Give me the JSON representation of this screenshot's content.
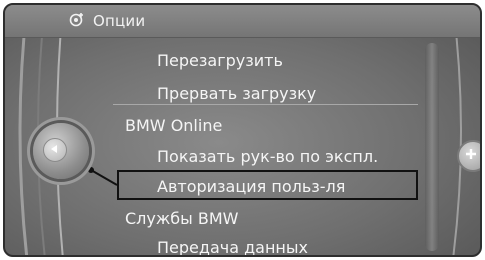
{
  "header": {
    "title": "Опции",
    "icon": "options-gear-icon"
  },
  "menu": {
    "items": [
      {
        "label": "Перезагрузить"
      },
      {
        "label": "Прервать загрузку"
      },
      {
        "label": "BMW Online"
      },
      {
        "label": "Показать рук-во по экспл."
      },
      {
        "label": "Авторизация польз-ля"
      },
      {
        "label": "Службы BMW"
      },
      {
        "label": "Передача данных"
      }
    ],
    "selected": "Авторизация польз-ля"
  },
  "controls": {
    "left_knob": "back-arrow-icon",
    "right_knob": "plus-icon"
  }
}
